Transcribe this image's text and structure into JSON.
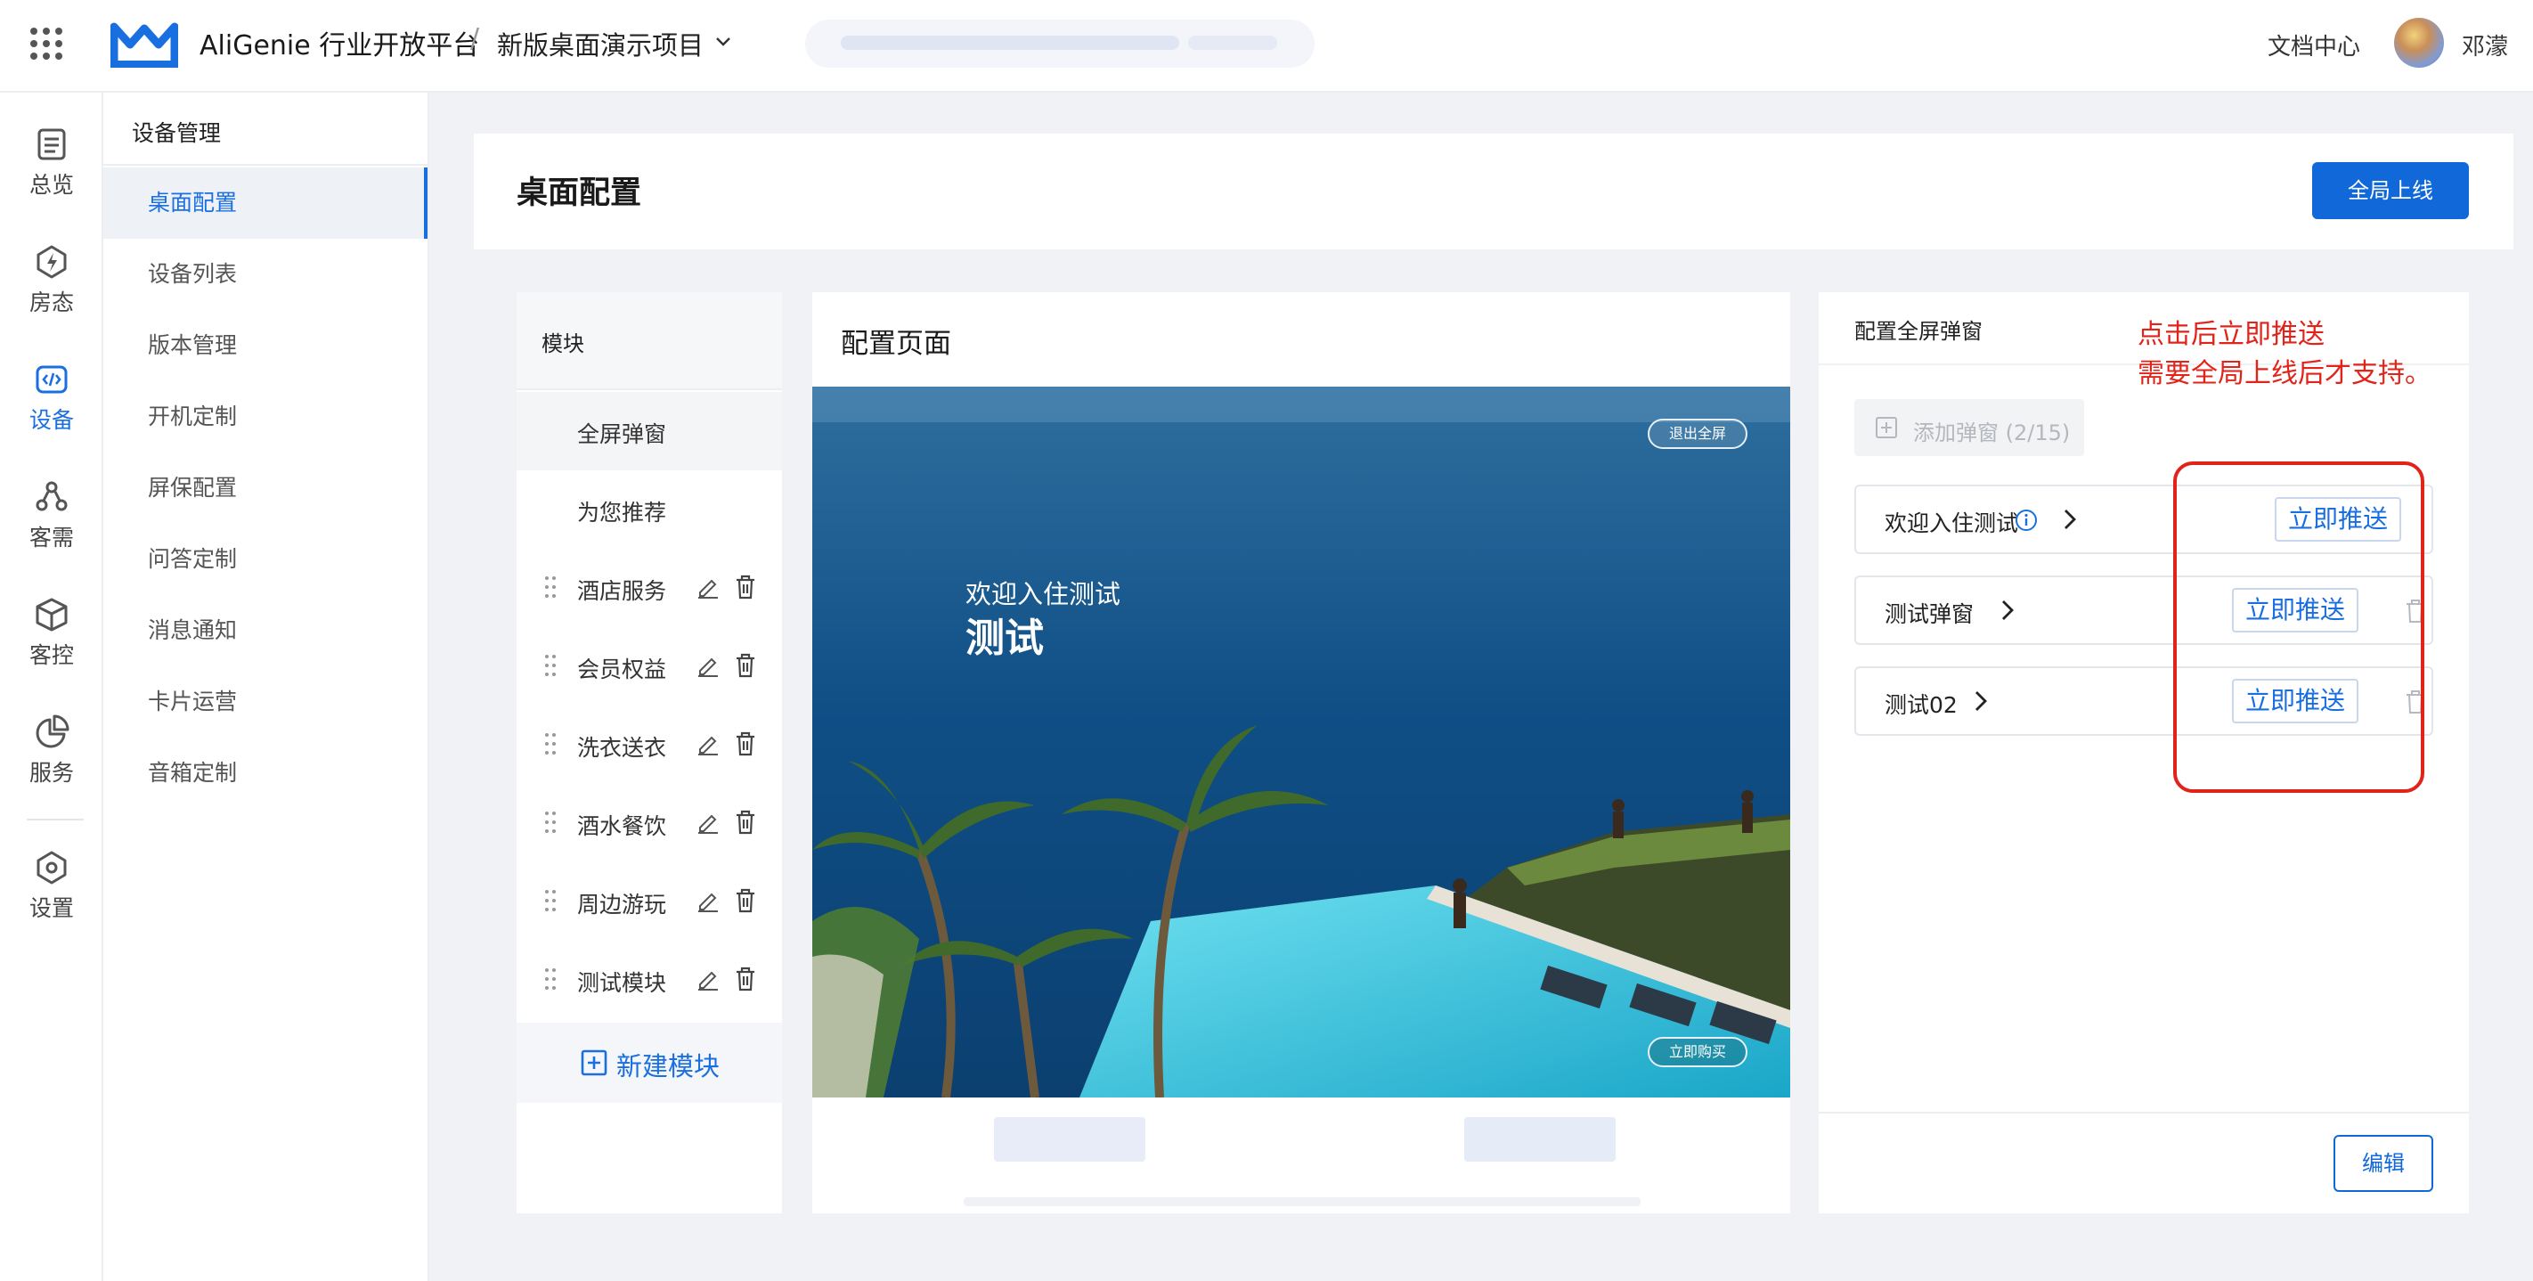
{
  "topbar": {
    "brand": "AliGenie 行业开放平台",
    "separator": "/",
    "project": "新版桌面演示项目",
    "docs": "文档中心",
    "user": "邓濛"
  },
  "rail": {
    "items": [
      {
        "label": "总览",
        "icon": "list-doc-icon"
      },
      {
        "label": "房态",
        "icon": "lightning-icon"
      },
      {
        "label": "设备",
        "icon": "code-icon"
      },
      {
        "label": "客需",
        "icon": "people-icon"
      },
      {
        "label": "客控",
        "icon": "cube-icon"
      },
      {
        "label": "服务",
        "icon": "pie-chart-icon"
      },
      {
        "label": "设置",
        "icon": "gear-icon"
      }
    ],
    "active": "设备"
  },
  "submenu": {
    "title": "设备管理",
    "items": [
      "桌面配置",
      "设备列表",
      "版本管理",
      "开机定制",
      "屏保配置",
      "问答定制",
      "消息通知",
      "卡片运营",
      "音箱定制"
    ],
    "active": "桌面配置"
  },
  "page": {
    "title": "桌面配置",
    "publish_label": "全局上线"
  },
  "modules": {
    "header": "模块",
    "items": [
      "全屏弹窗",
      "为您推荐",
      "酒店服务",
      "会员权益",
      "洗衣送衣",
      "酒水餐饮",
      "周边游玩",
      "测试模块"
    ],
    "new_label": "新建模块"
  },
  "config": {
    "title": "配置页面",
    "exit_fullscreen": "退出全屏",
    "buy_now": "立即购买",
    "overlay_sub": "欢迎入住测试",
    "overlay_main": "测试"
  },
  "popups": {
    "header": "配置全屏弹窗",
    "add_label": "添加弹窗 (2/15)",
    "rows": [
      {
        "name": "欢迎入住测试",
        "push": "立即推送"
      },
      {
        "name": "测试弹窗",
        "push": "立即推送"
      },
      {
        "name": "测试02",
        "push": "立即推送"
      }
    ],
    "edit_label": "编辑",
    "annotation_line1": "点击后立即推送",
    "annotation_line2": "需要全局上线后才支持。"
  },
  "colors": {
    "primary": "#1068d9",
    "active_text": "#1a6fe0",
    "annotation": "#e2231a"
  }
}
